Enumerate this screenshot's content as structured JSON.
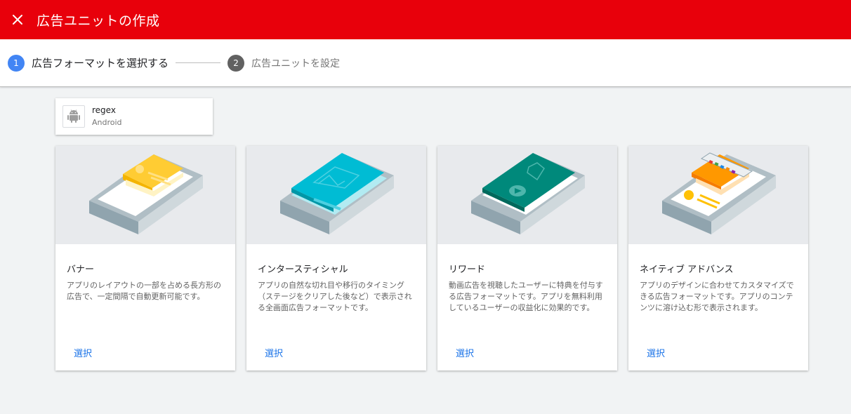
{
  "header": {
    "title": "広告ユニットの作成",
    "background": "#e8000b"
  },
  "stepper": {
    "steps": [
      {
        "number": "1",
        "label": "広告フォーマットを選択する",
        "state": "active"
      },
      {
        "number": "2",
        "label": "広告ユニットを設定",
        "state": "inactive"
      }
    ]
  },
  "app": {
    "name": "regex",
    "platform": "Android",
    "icon": "android-icon"
  },
  "cards": [
    {
      "title": "バナー",
      "description": "アプリのレイアウトの一部を占める長方形の広告で、一定間隔で自動更新可能です。",
      "select_label": "選択",
      "illustration": "banner-illustration-icon"
    },
    {
      "title": "インタースティシャル",
      "description": "アプリの自然な切れ目や移行のタイミング（ステージをクリアした後など）で表示される全画面広告フォーマットです。",
      "select_label": "選択",
      "illustration": "interstitial-illustration-icon"
    },
    {
      "title": "リワード",
      "description": "動画広告を視聴したユーザーに特典を付与する広告フォーマットです。アプリを無料利用しているユーザーの収益化に効果的です。",
      "select_label": "選択",
      "illustration": "rewarded-illustration-icon"
    },
    {
      "title": "ネイティブ アドバンス",
      "description": "アプリのデザインに合わせてカスタマイズできる広告フォーマットです。アプリのコンテンツに溶け込む形で表示されます。",
      "select_label": "選択",
      "illustration": "native-advanced-illustration-icon"
    }
  ],
  "colors": {
    "accent_blue": "#4285f4",
    "link_blue": "#1a73e8",
    "inactive_step": "#616161"
  }
}
